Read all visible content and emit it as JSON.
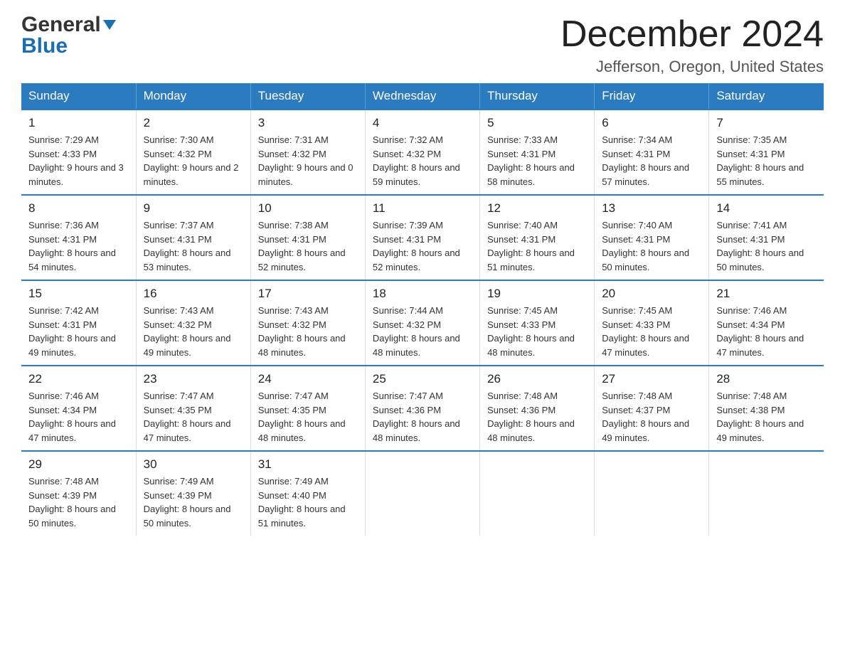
{
  "header": {
    "logo_line1": "General",
    "logo_line2": "Blue",
    "month_title": "December 2024",
    "location": "Jefferson, Oregon, United States"
  },
  "days_of_week": [
    "Sunday",
    "Monday",
    "Tuesday",
    "Wednesday",
    "Thursday",
    "Friday",
    "Saturday"
  ],
  "weeks": [
    [
      {
        "day": "1",
        "sunrise": "7:29 AM",
        "sunset": "4:33 PM",
        "daylight": "9 hours and 3 minutes."
      },
      {
        "day": "2",
        "sunrise": "7:30 AM",
        "sunset": "4:32 PM",
        "daylight": "9 hours and 2 minutes."
      },
      {
        "day": "3",
        "sunrise": "7:31 AM",
        "sunset": "4:32 PM",
        "daylight": "9 hours and 0 minutes."
      },
      {
        "day": "4",
        "sunrise": "7:32 AM",
        "sunset": "4:32 PM",
        "daylight": "8 hours and 59 minutes."
      },
      {
        "day": "5",
        "sunrise": "7:33 AM",
        "sunset": "4:31 PM",
        "daylight": "8 hours and 58 minutes."
      },
      {
        "day": "6",
        "sunrise": "7:34 AM",
        "sunset": "4:31 PM",
        "daylight": "8 hours and 57 minutes."
      },
      {
        "day": "7",
        "sunrise": "7:35 AM",
        "sunset": "4:31 PM",
        "daylight": "8 hours and 55 minutes."
      }
    ],
    [
      {
        "day": "8",
        "sunrise": "7:36 AM",
        "sunset": "4:31 PM",
        "daylight": "8 hours and 54 minutes."
      },
      {
        "day": "9",
        "sunrise": "7:37 AM",
        "sunset": "4:31 PM",
        "daylight": "8 hours and 53 minutes."
      },
      {
        "day": "10",
        "sunrise": "7:38 AM",
        "sunset": "4:31 PM",
        "daylight": "8 hours and 52 minutes."
      },
      {
        "day": "11",
        "sunrise": "7:39 AM",
        "sunset": "4:31 PM",
        "daylight": "8 hours and 52 minutes."
      },
      {
        "day": "12",
        "sunrise": "7:40 AM",
        "sunset": "4:31 PM",
        "daylight": "8 hours and 51 minutes."
      },
      {
        "day": "13",
        "sunrise": "7:40 AM",
        "sunset": "4:31 PM",
        "daylight": "8 hours and 50 minutes."
      },
      {
        "day": "14",
        "sunrise": "7:41 AM",
        "sunset": "4:31 PM",
        "daylight": "8 hours and 50 minutes."
      }
    ],
    [
      {
        "day": "15",
        "sunrise": "7:42 AM",
        "sunset": "4:31 PM",
        "daylight": "8 hours and 49 minutes."
      },
      {
        "day": "16",
        "sunrise": "7:43 AM",
        "sunset": "4:32 PM",
        "daylight": "8 hours and 49 minutes."
      },
      {
        "day": "17",
        "sunrise": "7:43 AM",
        "sunset": "4:32 PM",
        "daylight": "8 hours and 48 minutes."
      },
      {
        "day": "18",
        "sunrise": "7:44 AM",
        "sunset": "4:32 PM",
        "daylight": "8 hours and 48 minutes."
      },
      {
        "day": "19",
        "sunrise": "7:45 AM",
        "sunset": "4:33 PM",
        "daylight": "8 hours and 48 minutes."
      },
      {
        "day": "20",
        "sunrise": "7:45 AM",
        "sunset": "4:33 PM",
        "daylight": "8 hours and 47 minutes."
      },
      {
        "day": "21",
        "sunrise": "7:46 AM",
        "sunset": "4:34 PM",
        "daylight": "8 hours and 47 minutes."
      }
    ],
    [
      {
        "day": "22",
        "sunrise": "7:46 AM",
        "sunset": "4:34 PM",
        "daylight": "8 hours and 47 minutes."
      },
      {
        "day": "23",
        "sunrise": "7:47 AM",
        "sunset": "4:35 PM",
        "daylight": "8 hours and 47 minutes."
      },
      {
        "day": "24",
        "sunrise": "7:47 AM",
        "sunset": "4:35 PM",
        "daylight": "8 hours and 48 minutes."
      },
      {
        "day": "25",
        "sunrise": "7:47 AM",
        "sunset": "4:36 PM",
        "daylight": "8 hours and 48 minutes."
      },
      {
        "day": "26",
        "sunrise": "7:48 AM",
        "sunset": "4:36 PM",
        "daylight": "8 hours and 48 minutes."
      },
      {
        "day": "27",
        "sunrise": "7:48 AM",
        "sunset": "4:37 PM",
        "daylight": "8 hours and 49 minutes."
      },
      {
        "day": "28",
        "sunrise": "7:48 AM",
        "sunset": "4:38 PM",
        "daylight": "8 hours and 49 minutes."
      }
    ],
    [
      {
        "day": "29",
        "sunrise": "7:48 AM",
        "sunset": "4:39 PM",
        "daylight": "8 hours and 50 minutes."
      },
      {
        "day": "30",
        "sunrise": "7:49 AM",
        "sunset": "4:39 PM",
        "daylight": "8 hours and 50 minutes."
      },
      {
        "day": "31",
        "sunrise": "7:49 AM",
        "sunset": "4:40 PM",
        "daylight": "8 hours and 51 minutes."
      },
      null,
      null,
      null,
      null
    ]
  ],
  "labels": {
    "sunrise": "Sunrise:",
    "sunset": "Sunset:",
    "daylight": "Daylight:"
  }
}
